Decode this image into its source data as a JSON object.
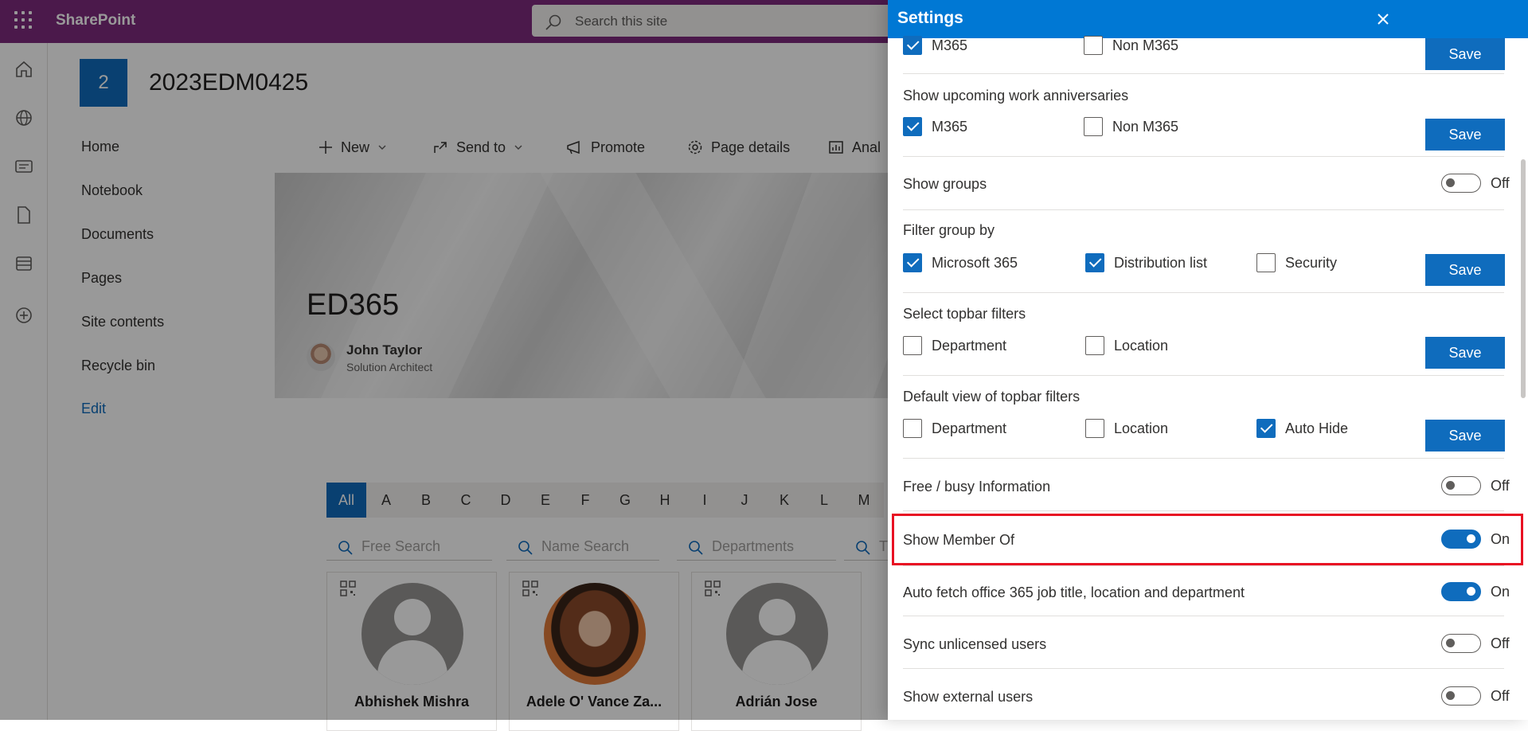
{
  "suitebar": {
    "brand": "SharePoint",
    "search_placeholder": "Search this site"
  },
  "site": {
    "logo_letter": "2",
    "title": "2023EDM0425"
  },
  "nav": [
    "Home",
    "Notebook",
    "Documents",
    "Pages",
    "Site contents",
    "Recycle bin"
  ],
  "nav_edit": "Edit",
  "commands": {
    "new": "New",
    "send_to": "Send to",
    "promote": "Promote",
    "page_details": "Page details",
    "analytics": "Anal"
  },
  "hero": {
    "title": "ED365",
    "author_name": "John Taylor",
    "author_role": "Solution Architect"
  },
  "alphabet": [
    "All",
    "A",
    "B",
    "C",
    "D",
    "E",
    "F",
    "G",
    "H",
    "I",
    "J",
    "K",
    "L",
    "M"
  ],
  "search_fields": {
    "free": "Free Search",
    "name": "Name Search",
    "departments": "Departments",
    "title_cut": "T"
  },
  "people": [
    "Abhishek Mishra",
    "Adele O' Vance Za...",
    "Adrián Jose"
  ],
  "settings": {
    "title": "Settings",
    "save_label": "Save",
    "birthdays": {
      "m365": "M365",
      "non_m365": "Non M365"
    },
    "anniversaries": {
      "title": "Show upcoming work anniversaries",
      "m365": "M365",
      "non_m365": "Non M365"
    },
    "show_groups": {
      "title": "Show groups",
      "state": "Off"
    },
    "filter_group": {
      "title": "Filter group by",
      "microsoft365": "Microsoft 365",
      "distribution": "Distribution list",
      "security": "Security"
    },
    "topbar_filters": {
      "title": "Select topbar filters",
      "department": "Department",
      "location": "Location"
    },
    "default_view": {
      "title": "Default view of topbar filters",
      "department": "Department",
      "location": "Location",
      "auto_hide": "Auto Hide"
    },
    "free_busy": {
      "title": "Free / busy Information",
      "state": "Off"
    },
    "member_of": {
      "title": "Show Member Of",
      "state": "On"
    },
    "auto_fetch": {
      "title": "Auto fetch office 365 job title, location and department",
      "state": "On"
    },
    "sync_unlicensed": {
      "title": "Sync unlicensed users",
      "state": "Off"
    },
    "external_users": {
      "title": "Show external users",
      "state": "Off"
    }
  },
  "colors": {
    "suitebar": "#7d2b7e",
    "panel_header": "#0078d4",
    "accent": "#0f6cbd",
    "highlight": "#e81123"
  }
}
